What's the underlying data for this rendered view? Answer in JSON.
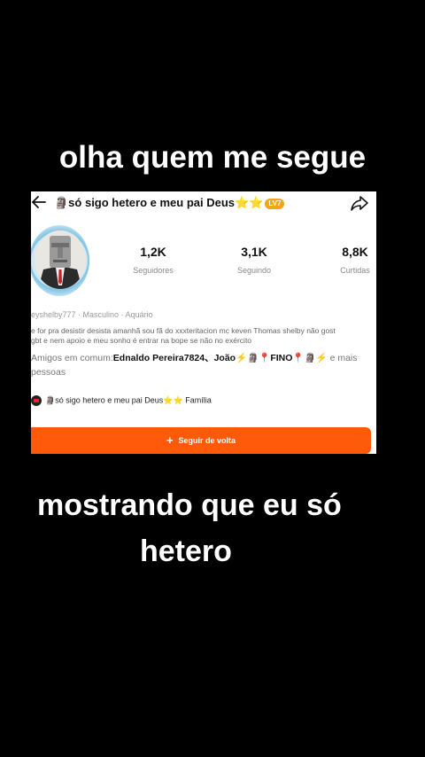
{
  "captions": {
    "top": "olha quem me segue",
    "bottom_line1": "mostrando que eu só",
    "bottom_line2": "hetero"
  },
  "profile": {
    "name_prefix": "🗿só sigo hetero e meu pai Deus",
    "name_stars": "⭐⭐",
    "level_badge": "LV7",
    "stats": [
      {
        "value": "1,2K",
        "label": "Seguidores"
      },
      {
        "value": "3,1K",
        "label": "Seguindo"
      },
      {
        "value": "8,8K",
        "label": "Curtidas"
      }
    ],
    "meta": "eyshelby777 · Masculino · Aquário",
    "bio_line1": "e for pra desistir desista amanhã sou fã do xxxteritacion mc keven Thomas shelby não gost",
    "bio_line2": "gbt e nem apoio e meu sonho é entrar na bope se não no exército",
    "friends_prefix": "Amigos em comum:",
    "friends_names": "Ednaldo Pereira7824、João",
    "friends_mid": "⚡🗿📍",
    "friends_fino": "FINO",
    "friends_tail": "📍🗿⚡",
    "friends_suffix": " e mais",
    "friends_line2": "pessoas",
    "group_name": "🗿só sigo hetero e meu pai Deus",
    "group_stars": "⭐⭐",
    "group_suffix": " Família",
    "follow_button": "Seguir de volta"
  },
  "colors": {
    "accent": "#fe5a09",
    "background": "#000000",
    "card": "#ffffff",
    "star": "#f5b301"
  }
}
